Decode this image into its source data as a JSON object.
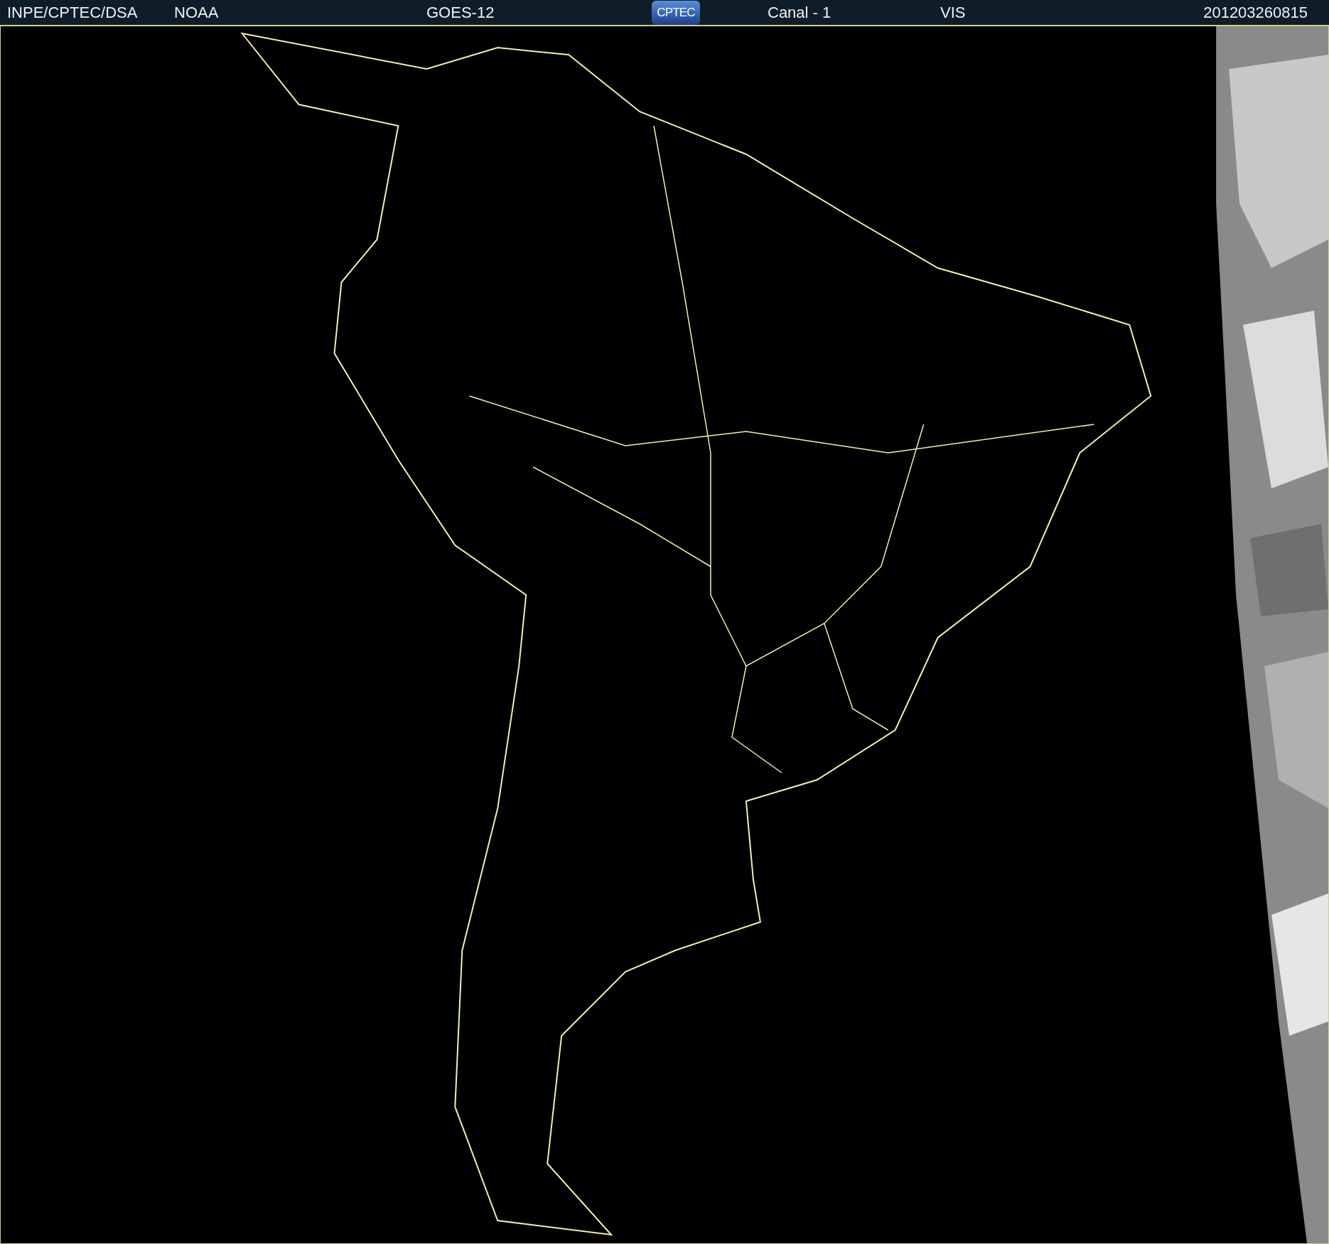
{
  "header": {
    "institution": "INPE/CPTEC/DSA",
    "agency": "NOAA",
    "satellite": "GOES-12",
    "logo": "CPTEC",
    "channel": "Canal - 1",
    "band": "VIS",
    "timestamp": "201203260815"
  }
}
